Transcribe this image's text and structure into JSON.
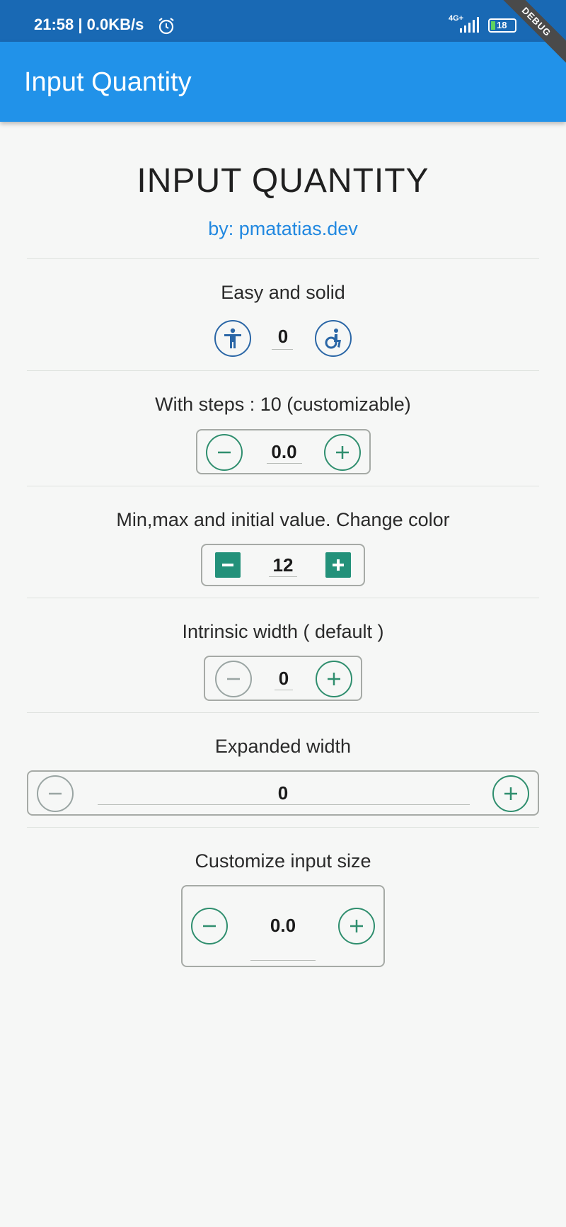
{
  "status_bar": {
    "time": "21:58",
    "speed": "| 0.0KB/s",
    "network": "4G+",
    "battery": "18",
    "debug": "DEBUG"
  },
  "app_bar": {
    "title": "Input Quantity"
  },
  "header": {
    "title": "INPUT QUANTITY",
    "author": "by: pmatatias.dev"
  },
  "sections": [
    {
      "label": "Easy and solid",
      "value": "0",
      "decrement_icon": "accessibility-icon",
      "increment_icon": "accessible-forward-icon"
    },
    {
      "label": "With steps : 10 (customizable)",
      "value": "0.0"
    },
    {
      "label": "Min,max and initial value. Change color",
      "value": "12"
    },
    {
      "label": "Intrinsic width ( default )",
      "value": "0"
    },
    {
      "label": "Expanded width",
      "value": "0"
    },
    {
      "label": "Customize input size",
      "value": "0.0"
    }
  ],
  "colors": {
    "app_bar": "#2192e9",
    "status_bar": "#1969b4",
    "accent_green": "#2f8e6e",
    "link_blue": "#2188e0"
  }
}
